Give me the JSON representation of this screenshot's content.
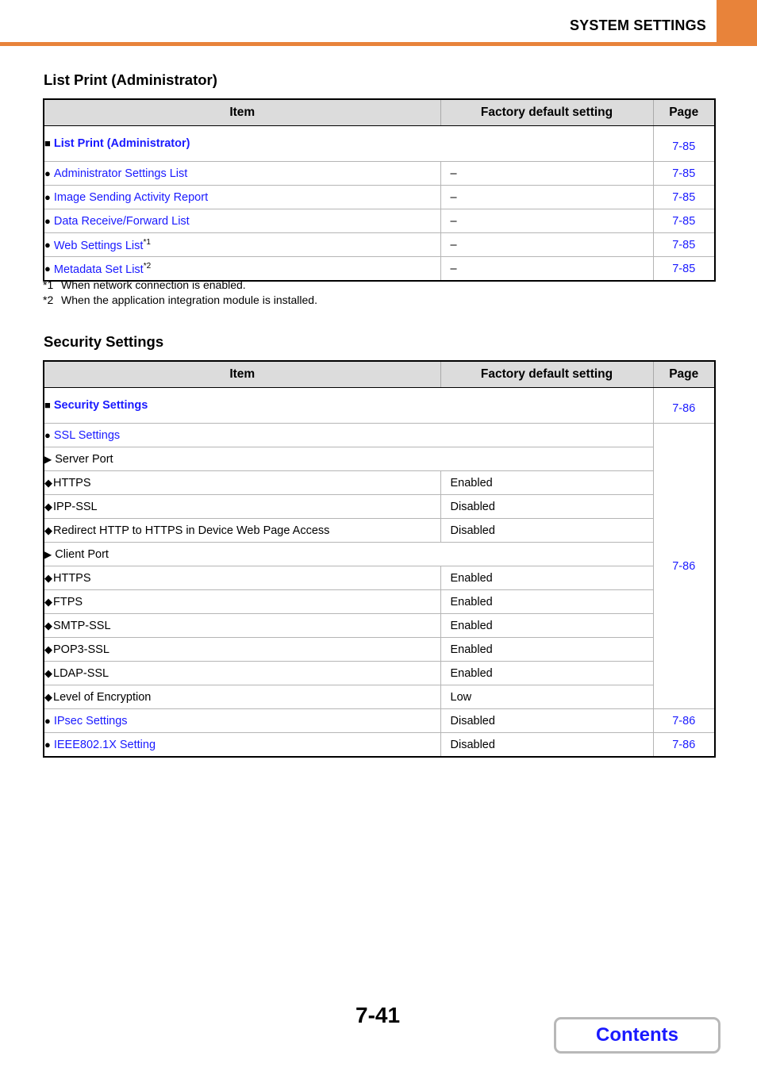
{
  "header": {
    "title": "SYSTEM SETTINGS",
    "accent_color": "#e8833a"
  },
  "columns": {
    "item": "Item",
    "default": "Factory default setting",
    "page": "Page"
  },
  "list_print": {
    "title": "List Print (Administrator)",
    "group": {
      "label": "List Print (Administrator)",
      "page": "7-85"
    },
    "rows": [
      {
        "label": "Administrator Settings List",
        "note": "",
        "default": "–",
        "page": "7-85"
      },
      {
        "label": "Image Sending Activity Report",
        "note": "",
        "default": "–",
        "page": "7-85"
      },
      {
        "label": "Data Receive/Forward List",
        "note": "",
        "default": "–",
        "page": "7-85"
      },
      {
        "label": "Web Settings List",
        "note": "*1",
        "default": "–",
        "page": "7-85"
      },
      {
        "label": "Metadata Set List",
        "note": "*2",
        "default": "–",
        "page": "7-85"
      }
    ],
    "footnotes": [
      {
        "mark": "*1",
        "text": "When network connection is enabled."
      },
      {
        "mark": "*2",
        "text": "When the application integration module is installed."
      }
    ]
  },
  "security": {
    "title": "Security Settings",
    "group": {
      "label": "Security Settings",
      "page": "7-86"
    },
    "ssl": {
      "label": "SSL Settings",
      "page": "7-86",
      "server_port": {
        "label": "Server Port",
        "items": [
          {
            "label": "HTTPS",
            "default": "Enabled"
          },
          {
            "label": "IPP-SSL",
            "default": "Disabled"
          },
          {
            "label": "Redirect HTTP to HTTPS in Device Web Page Access",
            "default": "Disabled"
          }
        ]
      },
      "client_port": {
        "label": "Client Port",
        "items": [
          {
            "label": "HTTPS",
            "default": "Enabled"
          },
          {
            "label": "FTPS",
            "default": "Enabled"
          },
          {
            "label": "SMTP-SSL",
            "default": "Enabled"
          },
          {
            "label": "POP3-SSL",
            "default": "Enabled"
          },
          {
            "label": "LDAP-SSL",
            "default": "Enabled"
          }
        ]
      },
      "encryption": {
        "label": "Level of Encryption",
        "default": "Low"
      }
    },
    "ipsec": {
      "label": "IPsec Settings",
      "default": "Disabled",
      "page": "7-86"
    },
    "ieee": {
      "label": "IEEE802.1X Setting",
      "default": "Disabled",
      "page": "7-86"
    }
  },
  "footer": {
    "page_number": "7-41",
    "contents_label": "Contents"
  },
  "icons": {
    "square": "■",
    "circle": "●",
    "triangle": "▶",
    "diamond": "◆"
  }
}
